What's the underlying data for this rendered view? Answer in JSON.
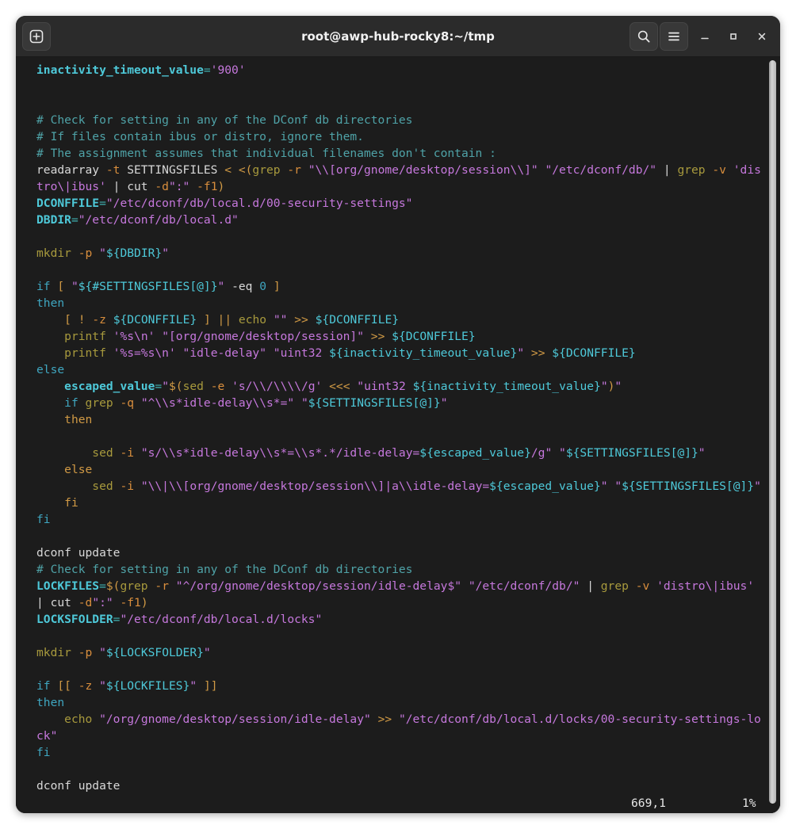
{
  "window": {
    "title": "root@awp-hub-rocky8:~/tmp",
    "background": "#1c1c1c",
    "titlebar_background": "#2b2b2b"
  },
  "titlebar": {
    "new_tab_label": "",
    "search_label": "",
    "menu_label": "",
    "minimize_label": "",
    "maximize_label": "",
    "close_label": "",
    "icons": {
      "new_tab": "new-tab-icon",
      "search": "search-icon",
      "menu": "hamburger-menu-icon",
      "minimize": "minimize-icon",
      "maximize": "maximize-icon",
      "close": "close-icon"
    }
  },
  "statusline": {
    "position": "669,1",
    "percent": "1%"
  },
  "colors": {
    "variable": "#4ec9d9",
    "string": "#c678dd",
    "comment": "#4fa3a8",
    "keyword_blue": "#3fa6c0",
    "keyword_orange": "#d19a45",
    "command": "#a89a3d",
    "flag": "#d98e3d",
    "default": "#d8d8d8"
  },
  "terminal": {
    "lines": [
      [
        {
          "t": "inactivity_timeout_value",
          "c": "c-var"
        },
        {
          "t": "=",
          "c": "c-op"
        },
        {
          "t": "'900'",
          "c": "c-str"
        }
      ],
      [],
      [],
      [
        {
          "t": "# Check for setting in any of the DConf db directories",
          "c": "c-cmt"
        }
      ],
      [
        {
          "t": "# If files contain ibus or distro, ignore them.",
          "c": "c-cmt"
        }
      ],
      [
        {
          "t": "# The assignment assumes that individual filenames don't contain :",
          "c": "c-cmt"
        }
      ],
      [
        {
          "t": "readarray ",
          "c": "c-def"
        },
        {
          "t": "-t",
          "c": "c-flag"
        },
        {
          "t": " SETTINGSFILES ",
          "c": "c-def"
        },
        {
          "t": "< <(",
          "c": "c-kw2"
        },
        {
          "t": "grep",
          "c": "c-cmd"
        },
        {
          "t": " ",
          "c": "c-def"
        },
        {
          "t": "-r",
          "c": "c-flag"
        },
        {
          "t": " ",
          "c": "c-def"
        },
        {
          "t": "\"\\\\[org/gnome/desktop/session\\\\]\"",
          "c": "c-str"
        },
        {
          "t": " ",
          "c": "c-def"
        },
        {
          "t": "\"/etc/dconf/db/\"",
          "c": "c-str"
        },
        {
          "t": " | ",
          "c": "c-def"
        },
        {
          "t": "grep",
          "c": "c-cmd"
        },
        {
          "t": " ",
          "c": "c-def"
        },
        {
          "t": "-v",
          "c": "c-flag"
        },
        {
          "t": " ",
          "c": "c-def"
        },
        {
          "t": "'dis",
          "c": "c-str"
        }
      ],
      [
        {
          "t": "tro\\|ibus'",
          "c": "c-str"
        },
        {
          "t": " | ",
          "c": "c-def"
        },
        {
          "t": "cut ",
          "c": "c-def"
        },
        {
          "t": "-d",
          "c": "c-flag"
        },
        {
          "t": "\":\"",
          "c": "c-str"
        },
        {
          "t": " ",
          "c": "c-def"
        },
        {
          "t": "-f1",
          "c": "c-flag"
        },
        {
          "t": ")",
          "c": "c-kw2"
        }
      ],
      [
        {
          "t": "DCONFFILE",
          "c": "c-var"
        },
        {
          "t": "=",
          "c": "c-op"
        },
        {
          "t": "\"/etc/dconf/db/local.d/00-security-settings\"",
          "c": "c-str"
        }
      ],
      [
        {
          "t": "DBDIR",
          "c": "c-var"
        },
        {
          "t": "=",
          "c": "c-op"
        },
        {
          "t": "\"/etc/dconf/db/local.d\"",
          "c": "c-str"
        }
      ],
      [],
      [
        {
          "t": "mkdir",
          "c": "c-cmd"
        },
        {
          "t": " ",
          "c": "c-def"
        },
        {
          "t": "-p",
          "c": "c-flag"
        },
        {
          "t": " ",
          "c": "c-def"
        },
        {
          "t": "\"",
          "c": "c-str"
        },
        {
          "t": "${DBDIR}",
          "c": "c-varref"
        },
        {
          "t": "\"",
          "c": "c-str"
        }
      ],
      [],
      [
        {
          "t": "if",
          "c": "c-kw"
        },
        {
          "t": " ",
          "c": "c-def"
        },
        {
          "t": "[",
          "c": "c-kw2"
        },
        {
          "t": " ",
          "c": "c-def"
        },
        {
          "t": "\"",
          "c": "c-str"
        },
        {
          "t": "${#SETTINGSFILES[@]}",
          "c": "c-varref"
        },
        {
          "t": "\"",
          "c": "c-str"
        },
        {
          "t": " ",
          "c": "c-def"
        },
        {
          "t": "-eq",
          "c": "c-def"
        },
        {
          "t": " ",
          "c": "c-def"
        },
        {
          "t": "0",
          "c": "c-num"
        },
        {
          "t": " ",
          "c": "c-def"
        },
        {
          "t": "]",
          "c": "c-kw2"
        }
      ],
      [
        {
          "t": "then",
          "c": "c-kw"
        }
      ],
      [
        {
          "t": "    ",
          "c": "c-def"
        },
        {
          "t": "[",
          "c": "c-kw2"
        },
        {
          "t": " ",
          "c": "c-def"
        },
        {
          "t": "!",
          "c": "c-kw2"
        },
        {
          "t": " ",
          "c": "c-def"
        },
        {
          "t": "-z",
          "c": "c-flag"
        },
        {
          "t": " ",
          "c": "c-def"
        },
        {
          "t": "${DCONFFILE}",
          "c": "c-varref"
        },
        {
          "t": " ",
          "c": "c-def"
        },
        {
          "t": "]",
          "c": "c-kw2"
        },
        {
          "t": " ",
          "c": "c-def"
        },
        {
          "t": "||",
          "c": "c-kw2"
        },
        {
          "t": " ",
          "c": "c-def"
        },
        {
          "t": "echo",
          "c": "c-cmd"
        },
        {
          "t": " ",
          "c": "c-def"
        },
        {
          "t": "\"\"",
          "c": "c-str"
        },
        {
          "t": " ",
          "c": "c-def"
        },
        {
          "t": ">>",
          "c": "c-kw2"
        },
        {
          "t": " ",
          "c": "c-def"
        },
        {
          "t": "${DCONFFILE}",
          "c": "c-varref"
        }
      ],
      [
        {
          "t": "    ",
          "c": "c-def"
        },
        {
          "t": "printf",
          "c": "c-cmd"
        },
        {
          "t": " ",
          "c": "c-def"
        },
        {
          "t": "'%s\\n'",
          "c": "c-str"
        },
        {
          "t": " ",
          "c": "c-def"
        },
        {
          "t": "\"[org/gnome/desktop/session]\"",
          "c": "c-str"
        },
        {
          "t": " ",
          "c": "c-def"
        },
        {
          "t": ">>",
          "c": "c-kw2"
        },
        {
          "t": " ",
          "c": "c-def"
        },
        {
          "t": "${DCONFFILE}",
          "c": "c-varref"
        }
      ],
      [
        {
          "t": "    ",
          "c": "c-def"
        },
        {
          "t": "printf",
          "c": "c-cmd"
        },
        {
          "t": " ",
          "c": "c-def"
        },
        {
          "t": "'%s=%s\\n'",
          "c": "c-str"
        },
        {
          "t": " ",
          "c": "c-def"
        },
        {
          "t": "\"idle-delay\"",
          "c": "c-str"
        },
        {
          "t": " ",
          "c": "c-def"
        },
        {
          "t": "\"uint32 ",
          "c": "c-str"
        },
        {
          "t": "${inactivity_timeout_value}",
          "c": "c-varref"
        },
        {
          "t": "\"",
          "c": "c-str"
        },
        {
          "t": " ",
          "c": "c-def"
        },
        {
          "t": ">>",
          "c": "c-kw2"
        },
        {
          "t": " ",
          "c": "c-def"
        },
        {
          "t": "${DCONFFILE}",
          "c": "c-varref"
        }
      ],
      [
        {
          "t": "else",
          "c": "c-kw"
        }
      ],
      [
        {
          "t": "    ",
          "c": "c-def"
        },
        {
          "t": "escaped_value",
          "c": "c-var"
        },
        {
          "t": "=",
          "c": "c-op"
        },
        {
          "t": "\"",
          "c": "c-str"
        },
        {
          "t": "$(",
          "c": "c-kw2"
        },
        {
          "t": "sed",
          "c": "c-cmd"
        },
        {
          "t": " ",
          "c": "c-def"
        },
        {
          "t": "-e",
          "c": "c-flag"
        },
        {
          "t": " ",
          "c": "c-def"
        },
        {
          "t": "'s/\\\\/\\\\\\\\/g'",
          "c": "c-str"
        },
        {
          "t": " ",
          "c": "c-def"
        },
        {
          "t": "<<<",
          "c": "c-kw2"
        },
        {
          "t": " ",
          "c": "c-def"
        },
        {
          "t": "\"uint32 ",
          "c": "c-str"
        },
        {
          "t": "${inactivity_timeout_value}",
          "c": "c-varref"
        },
        {
          "t": "\"",
          "c": "c-str"
        },
        {
          "t": ")",
          "c": "c-kw2"
        },
        {
          "t": "\"",
          "c": "c-str"
        }
      ],
      [
        {
          "t": "    ",
          "c": "c-def"
        },
        {
          "t": "if",
          "c": "c-kw"
        },
        {
          "t": " ",
          "c": "c-def"
        },
        {
          "t": "grep",
          "c": "c-cmd"
        },
        {
          "t": " ",
          "c": "c-def"
        },
        {
          "t": "-q",
          "c": "c-flag"
        },
        {
          "t": " ",
          "c": "c-def"
        },
        {
          "t": "\"^\\\\s*idle-delay\\\\s*=\"",
          "c": "c-str"
        },
        {
          "t": " ",
          "c": "c-def"
        },
        {
          "t": "\"",
          "c": "c-str"
        },
        {
          "t": "${SETTINGSFILES[@]}",
          "c": "c-varref"
        },
        {
          "t": "\"",
          "c": "c-str"
        }
      ],
      [
        {
          "t": "    ",
          "c": "c-def"
        },
        {
          "t": "then",
          "c": "c-kw2"
        }
      ],
      [],
      [
        {
          "t": "        ",
          "c": "c-def"
        },
        {
          "t": "sed",
          "c": "c-cmd"
        },
        {
          "t": " ",
          "c": "c-def"
        },
        {
          "t": "-i",
          "c": "c-flag"
        },
        {
          "t": " ",
          "c": "c-def"
        },
        {
          "t": "\"s/\\\\s*idle-delay\\\\s*=\\\\s*.*/idle-delay=",
          "c": "c-str"
        },
        {
          "t": "${escaped_value}",
          "c": "c-varref"
        },
        {
          "t": "/g\"",
          "c": "c-str"
        },
        {
          "t": " ",
          "c": "c-def"
        },
        {
          "t": "\"",
          "c": "c-str"
        },
        {
          "t": "${SETTINGSFILES[@]}",
          "c": "c-varref"
        },
        {
          "t": "\"",
          "c": "c-str"
        }
      ],
      [
        {
          "t": "    ",
          "c": "c-def"
        },
        {
          "t": "else",
          "c": "c-kw2"
        }
      ],
      [
        {
          "t": "        ",
          "c": "c-def"
        },
        {
          "t": "sed",
          "c": "c-cmd"
        },
        {
          "t": " ",
          "c": "c-def"
        },
        {
          "t": "-i",
          "c": "c-flag"
        },
        {
          "t": " ",
          "c": "c-def"
        },
        {
          "t": "\"\\\\|\\\\[org/gnome/desktop/session\\\\]|a\\\\idle-delay=",
          "c": "c-str"
        },
        {
          "t": "${escaped_value}",
          "c": "c-varref"
        },
        {
          "t": "\"",
          "c": "c-str"
        },
        {
          "t": " ",
          "c": "c-def"
        },
        {
          "t": "\"",
          "c": "c-str"
        },
        {
          "t": "${SETTINGSFILES[@]}",
          "c": "c-varref"
        },
        {
          "t": "\"",
          "c": "c-str"
        }
      ],
      [
        {
          "t": "    ",
          "c": "c-def"
        },
        {
          "t": "fi",
          "c": "c-kw2"
        }
      ],
      [
        {
          "t": "fi",
          "c": "c-kw"
        }
      ],
      [],
      [
        {
          "t": "dconf update",
          "c": "c-def"
        }
      ],
      [
        {
          "t": "# Check for setting in any of the DConf db directories",
          "c": "c-cmt"
        }
      ],
      [
        {
          "t": "LOCKFILES",
          "c": "c-var"
        },
        {
          "t": "=",
          "c": "c-op"
        },
        {
          "t": "$(",
          "c": "c-kw2"
        },
        {
          "t": "grep",
          "c": "c-cmd"
        },
        {
          "t": " ",
          "c": "c-def"
        },
        {
          "t": "-r",
          "c": "c-flag"
        },
        {
          "t": " ",
          "c": "c-def"
        },
        {
          "t": "\"^/org/gnome/desktop/session/idle-delay$\"",
          "c": "c-str"
        },
        {
          "t": " ",
          "c": "c-def"
        },
        {
          "t": "\"/etc/dconf/db/\"",
          "c": "c-str"
        },
        {
          "t": " | ",
          "c": "c-def"
        },
        {
          "t": "grep",
          "c": "c-cmd"
        },
        {
          "t": " ",
          "c": "c-def"
        },
        {
          "t": "-v",
          "c": "c-flag"
        },
        {
          "t": " ",
          "c": "c-def"
        },
        {
          "t": "'distro\\|ibus'",
          "c": "c-str"
        }
      ],
      [
        {
          "t": "| ",
          "c": "c-def"
        },
        {
          "t": "cut ",
          "c": "c-def"
        },
        {
          "t": "-d",
          "c": "c-flag"
        },
        {
          "t": "\":\"",
          "c": "c-str"
        },
        {
          "t": " ",
          "c": "c-def"
        },
        {
          "t": "-f1",
          "c": "c-flag"
        },
        {
          "t": ")",
          "c": "c-kw2"
        }
      ],
      [
        {
          "t": "LOCKSFOLDER",
          "c": "c-var"
        },
        {
          "t": "=",
          "c": "c-op"
        },
        {
          "t": "\"/etc/dconf/db/local.d/locks\"",
          "c": "c-str"
        }
      ],
      [],
      [
        {
          "t": "mkdir",
          "c": "c-cmd"
        },
        {
          "t": " ",
          "c": "c-def"
        },
        {
          "t": "-p",
          "c": "c-flag"
        },
        {
          "t": " ",
          "c": "c-def"
        },
        {
          "t": "\"",
          "c": "c-str"
        },
        {
          "t": "${LOCKSFOLDER}",
          "c": "c-varref"
        },
        {
          "t": "\"",
          "c": "c-str"
        }
      ],
      [],
      [
        {
          "t": "if",
          "c": "c-kw"
        },
        {
          "t": " ",
          "c": "c-def"
        },
        {
          "t": "[[",
          "c": "c-kw2"
        },
        {
          "t": " ",
          "c": "c-def"
        },
        {
          "t": "-z",
          "c": "c-flag"
        },
        {
          "t": " ",
          "c": "c-def"
        },
        {
          "t": "\"",
          "c": "c-str"
        },
        {
          "t": "${LOCKFILES}",
          "c": "c-varref"
        },
        {
          "t": "\"",
          "c": "c-str"
        },
        {
          "t": " ",
          "c": "c-def"
        },
        {
          "t": "]]",
          "c": "c-kw2"
        }
      ],
      [
        {
          "t": "then",
          "c": "c-kw"
        }
      ],
      [
        {
          "t": "    ",
          "c": "c-def"
        },
        {
          "t": "echo",
          "c": "c-cmd"
        },
        {
          "t": " ",
          "c": "c-def"
        },
        {
          "t": "\"/org/gnome/desktop/session/idle-delay\"",
          "c": "c-str"
        },
        {
          "t": " ",
          "c": "c-def"
        },
        {
          "t": ">>",
          "c": "c-kw2"
        },
        {
          "t": " ",
          "c": "c-def"
        },
        {
          "t": "\"/etc/dconf/db/local.d/locks/00-security-settings-lo",
          "c": "c-str"
        }
      ],
      [
        {
          "t": "ck\"",
          "c": "c-str"
        }
      ],
      [
        {
          "t": "fi",
          "c": "c-kw"
        }
      ],
      [],
      [
        {
          "t": "dconf update",
          "c": "c-def"
        }
      ]
    ]
  }
}
